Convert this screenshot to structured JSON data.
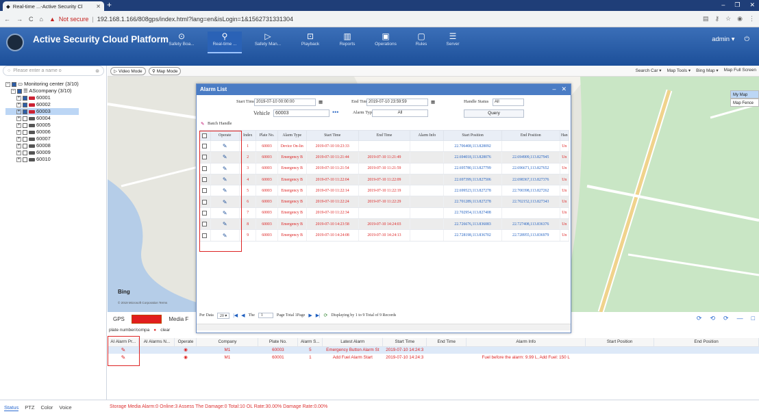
{
  "browser": {
    "tab_title": "Real-time ...-Active Security Cl",
    "new_tab": "+",
    "not_secure": "Not secure",
    "url": "192.168.1.166/808gps/index.html?lang=en&isLogin=1&1562731331304",
    "back": "←",
    "forward": "→",
    "reload": "C",
    "home": "⌂"
  },
  "app": {
    "title": "Active Security Cloud Platform",
    "user": "admin ▾",
    "power": "⏻"
  },
  "nav": [
    {
      "icon": "⊙",
      "label": "Safety Boa..."
    },
    {
      "icon": "⚲",
      "label": "Real-time ..."
    },
    {
      "icon": "▷",
      "label": "Safety Man..."
    },
    {
      "icon": "⊡",
      "label": "Playback"
    },
    {
      "icon": "▥",
      "label": "Reports"
    },
    {
      "icon": "▣",
      "label": "Operations"
    },
    {
      "icon": "▢",
      "label": "Rules"
    },
    {
      "icon": "☰",
      "label": "Server"
    }
  ],
  "sidebar": {
    "search_placeholder": "Please enter a name o",
    "tree": [
      {
        "label": "Monitoring center (3/10)",
        "level": 0
      },
      {
        "label": "AScompany (3/10)",
        "level": 1
      },
      {
        "label": "60001",
        "level": 2,
        "online": true
      },
      {
        "label": "60002",
        "level": 2,
        "online": true
      },
      {
        "label": "60003",
        "level": 2,
        "online": true,
        "selected": true
      },
      {
        "label": "60004",
        "level": 2,
        "online": false
      },
      {
        "label": "60005",
        "level": 2,
        "online": false
      },
      {
        "label": "60006",
        "level": 2,
        "online": false
      },
      {
        "label": "60007",
        "level": 2,
        "online": false
      },
      {
        "label": "60008",
        "level": 2,
        "online": false
      },
      {
        "label": "60009",
        "level": 2,
        "online": false
      },
      {
        "label": "60010",
        "level": 2,
        "online": false
      }
    ]
  },
  "maptoolbar": {
    "video_mode": "Video Mode",
    "map_mode": "Map Mode",
    "search_car": "Search Car ▾",
    "map_tools": "Map Tools ▾",
    "bing_map": "Bing Map ▾",
    "full_screen": "Map Full Screen",
    "my_map": "My Map",
    "map_fence": "Map Fence",
    "bing": "Bing",
    "copyright": "© 2019 Microsoft Corporation  Terms"
  },
  "dialog": {
    "title": "Alarm List",
    "start_time_label": "Start Time",
    "start_time": "2019-07-10 00:00:00",
    "end_time_label": "End Time",
    "end_time": "2019-07-10 23:59:59",
    "handle_status_label": "Handle Status",
    "handle_status": "All",
    "vehicle_label": "Vehicle",
    "vehicle": "60003",
    "alarm_type_label": "Alarm Type",
    "alarm_type": "All",
    "query": "Query",
    "batch_handle": "Batch Handle",
    "columns": [
      "",
      "Operate",
      "Index",
      "Plate No.",
      "Alarm Type",
      "Start Time",
      "End Time",
      "Alarm Info",
      "Start Position",
      "End Position",
      "Han"
    ],
    "rows": [
      {
        "index": "1",
        "plate": "60003",
        "type": "Device On-lin",
        "start": "2019-07-10 10:23:33",
        "end": "",
        "info": "",
        "spos": "22.706408,113.828092",
        "epos": "",
        "h": "Un"
      },
      {
        "index": "2",
        "plate": "60003",
        "type": "Emergency B",
        "start": "2019-07-10 11:21:44",
        "end": "2019-07-10 11:21:49",
        "info": "",
        "spos": "22.694018,113.828076",
        "epos": "22.694909,113.827945",
        "h": "Un"
      },
      {
        "index": "3",
        "plate": "60003",
        "type": "Emergency B",
        "start": "2019-07-10 11:21:54",
        "end": "2019-07-10 11:21:59",
        "info": "",
        "spos": "22.695780,113.827799",
        "epos": "22.696671,113.827652",
        "h": "Un"
      },
      {
        "index": "4",
        "plate": "60003",
        "type": "Emergency B",
        "start": "2019-07-10 11:22:04",
        "end": "2019-07-10 11:22:09",
        "info": "",
        "spos": "22.697399,113.827506",
        "epos": "22.698367,113.827376",
        "h": "Un"
      },
      {
        "index": "5",
        "plate": "60003",
        "type": "Emergency B",
        "start": "2019-07-10 11:22:14",
        "end": "2019-07-10 11:22:19",
        "info": "",
        "spos": "22.699523,113.827278",
        "epos": "22.700398,113.827262",
        "h": "Un"
      },
      {
        "index": "6",
        "plate": "60003",
        "type": "Emergency B",
        "start": "2019-07-10 11:22:24",
        "end": "2019-07-10 11:22:29",
        "info": "",
        "spos": "22.701289,113.827278",
        "epos": "22.702152,113.827343",
        "h": "Un"
      },
      {
        "index": "7",
        "plate": "60003",
        "type": "Emergency B",
        "start": "2019-07-10 11:22:34",
        "end": "",
        "info": "",
        "spos": "22.702954,113.827408",
        "epos": "",
        "h": "Un"
      },
      {
        "index": "8",
        "plate": "60003",
        "type": "Emergency B",
        "start": "2019-07-10 14:23:58",
        "end": "2019-07-10 14:24:03",
        "info": "",
        "spos": "22.726676,113.836083",
        "epos": "22.727408,113.836376",
        "h": "Un"
      },
      {
        "index": "9",
        "plate": "60003",
        "type": "Emergency B",
        "start": "2019-07-10 14:24:08",
        "end": "2019-07-10 14:24:13",
        "info": "",
        "spos": "22.728198,113.836702",
        "epos": "22.728955,113.836979",
        "h": "Un"
      }
    ],
    "pager": {
      "per_data_label": "Per Data",
      "per_data": "20 ▾",
      "the_label": "The",
      "page": "1",
      "page_total": "Page Total 1Page",
      "summary": "Displaying by 1 to 9 Total of 9 Records"
    }
  },
  "bottom": {
    "tabs": [
      "GPS",
      "Alarm Info",
      "Media F"
    ],
    "filter_placeholder": "plate number/compa",
    "clear": "clear",
    "columns": [
      "AI Alarm Pr...",
      "AI Alarms N...",
      "Operate",
      "Company",
      "Plate No.",
      "Alarm S...",
      "Latest Alarm",
      "Start Time",
      "End Time",
      "Alarm Info",
      "Start Position",
      "End Position"
    ],
    "rows": [
      {
        "company": "M1",
        "plate": "60003",
        "count": "5",
        "latest": "Emergency Button Alarm St",
        "start": "2019-07-10 14:24:3",
        "end": "",
        "info": "",
        "spos": "",
        "epos": ""
      },
      {
        "company": "M1",
        "plate": "60001",
        "count": "1",
        "latest": "Add Fuel Alarm Start",
        "start": "2019-07-10 14:24:3",
        "end": "",
        "info": "Fuel before the alarm: 9.99 L, Add Fuel: 150 L",
        "spos": "",
        "epos": ""
      }
    ]
  },
  "status": {
    "tabs": [
      "Status",
      "PTZ",
      "Color",
      "Voice"
    ],
    "summary": "Storage Media Alarm:0  Online:3  Assess The Damage:0  Total:10  OL Rate:30.00%  Damage Rate:0.00%"
  }
}
